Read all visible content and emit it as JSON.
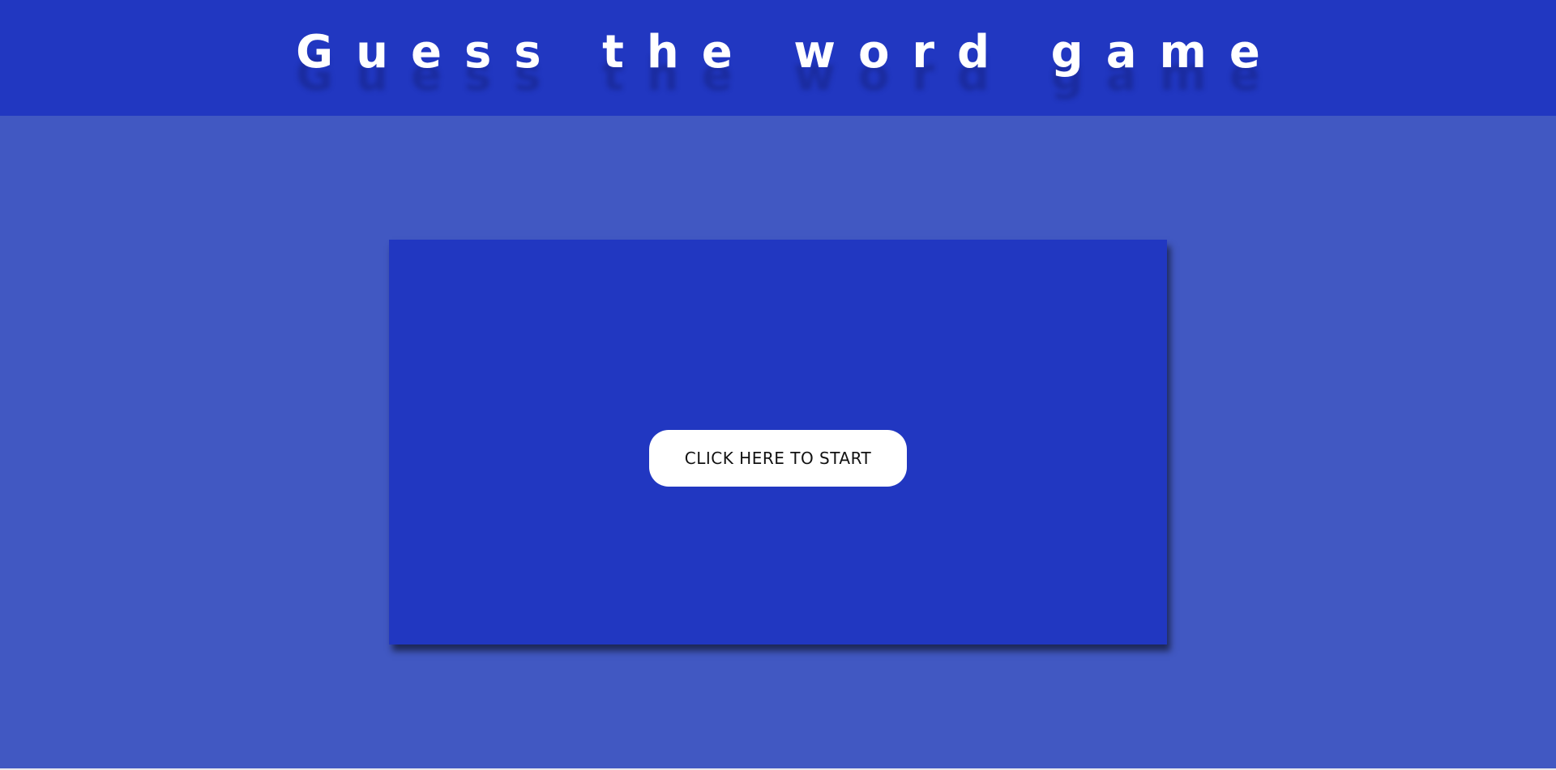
{
  "header": {
    "title": "Guess the word game"
  },
  "game": {
    "start_button_label": "CLICK HERE TO START"
  },
  "colors": {
    "page_background": "#4158c2",
    "header_background": "#2137c1",
    "panel_background": "#2137c1",
    "button_background": "#ffffff",
    "button_text": "#111111",
    "title_text": "#ffffff"
  }
}
